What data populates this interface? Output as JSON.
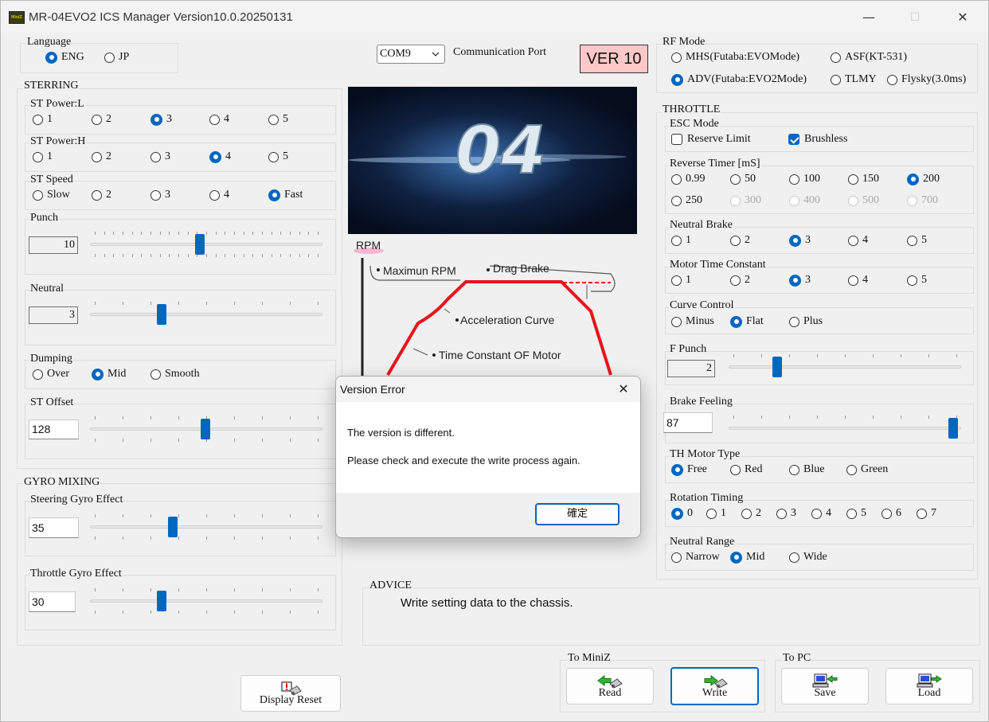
{
  "window": {
    "title": "MR-04EVO2 ICS Manager Version10.0.20250131",
    "minimize": "—",
    "maximize": "☐",
    "close": "✕"
  },
  "language": {
    "label": "Language",
    "options": [
      "ENG",
      "JP"
    ],
    "selected": "ENG"
  },
  "comm": {
    "port_value": "COM9",
    "port_label": "Communication Port",
    "ver_badge": "VER 10"
  },
  "steering": {
    "label": "STERRING",
    "st_power_l": {
      "label": "ST Power:L",
      "options": [
        "1",
        "2",
        "3",
        "4",
        "5"
      ],
      "selected": "3"
    },
    "st_power_h": {
      "label": "ST Power:H",
      "options": [
        "1",
        "2",
        "3",
        "4",
        "5"
      ],
      "selected": "4"
    },
    "st_speed": {
      "label": "ST Speed",
      "options": [
        "Slow",
        "2",
        "3",
        "4",
        "Fast"
      ],
      "selected": "Fast"
    },
    "punch": {
      "label": "Punch",
      "value": "10"
    },
    "neutral": {
      "label": "Neutral",
      "value": "3"
    },
    "dumping": {
      "label": "Dumping",
      "options": [
        "Over",
        "Mid",
        "Smooth"
      ],
      "selected": "Mid"
    },
    "st_offset": {
      "label": "ST Offset",
      "value": "128"
    }
  },
  "gyro": {
    "label": "GYRO MIXING",
    "steering_gyro": {
      "label": "Steering Gyro Effect",
      "value": "35"
    },
    "throttle_gyro": {
      "label": "Throttle Gyro Effect",
      "value": "30"
    }
  },
  "display_reset": {
    "label": "Display Reset"
  },
  "banner": {
    "text": "04"
  },
  "diagram": {
    "rpm": "RPM",
    "max_rpm": "Maximun RPM",
    "drag_brake": "Drag Brake",
    "accel_curve": "Acceleration Curve",
    "time_constant": "Time Constant OF Motor"
  },
  "dialog": {
    "title": "Version Error",
    "line1": "The version is different.",
    "line2": "Please check and execute the write process again.",
    "ok": "確定"
  },
  "advice": {
    "label": "ADVICE",
    "text": "Write setting data to the chassis."
  },
  "rf_mode": {
    "label": "RF Mode",
    "options": [
      "MHS(Futaba:EVOMode)",
      "ASF(KT-531)",
      "ADV(Futaba:EVO2Mode)",
      "TLMY",
      "Flysky(3.0ms)"
    ],
    "selected": "ADV(Futaba:EVO2Mode)"
  },
  "throttle": {
    "label": "THROTTLE",
    "esc_mode": {
      "label": "ESC Mode",
      "reserve_limit": "Reserve Limit",
      "reserve_checked": false,
      "brushless": "Brushless",
      "brushless_checked": true
    },
    "reverse_timer": {
      "label": "Reverse Timer [mS]",
      "options": [
        "0.99",
        "50",
        "100",
        "150",
        "200",
        "250",
        "300",
        "400",
        "500",
        "700"
      ],
      "selected": "200",
      "disabled": [
        "300",
        "400",
        "500",
        "700"
      ]
    },
    "neutral_brake": {
      "label": "Neutral Brake",
      "options": [
        "1",
        "2",
        "3",
        "4",
        "5"
      ],
      "selected": "3"
    },
    "motor_time_constant": {
      "label": "Motor Time Constant",
      "options": [
        "1",
        "2",
        "3",
        "4",
        "5"
      ],
      "selected": "3"
    },
    "curve_control": {
      "label": "Curve Control",
      "options": [
        "Minus",
        "Flat",
        "Plus"
      ],
      "selected": "Flat"
    },
    "f_punch": {
      "label": "F Punch",
      "value": "2"
    },
    "brake_feeling": {
      "label": "Brake Feeling",
      "value": "87"
    },
    "th_motor_type": {
      "label": "TH Motor Type",
      "options": [
        "Free",
        "Red",
        "Blue",
        "Green"
      ],
      "selected": "Free"
    },
    "rotation_timing": {
      "label": "Rotation Timing",
      "options": [
        "0",
        "1",
        "2",
        "3",
        "4",
        "5",
        "6",
        "7"
      ],
      "selected": "0"
    },
    "neutral_range": {
      "label": "Neutral Range",
      "options": [
        "Narrow",
        "Mid",
        "Wide"
      ],
      "selected": "Mid"
    }
  },
  "to_miniz": {
    "label": "To MiniZ",
    "read": "Read",
    "write": "Write"
  },
  "to_pc": {
    "label": "To PC",
    "save": "Save",
    "load": "Load"
  },
  "colors": {
    "accent": "#0067c0",
    "ver_badge_bg": "#ffc8c8",
    "curve_red": "#e8141c"
  }
}
